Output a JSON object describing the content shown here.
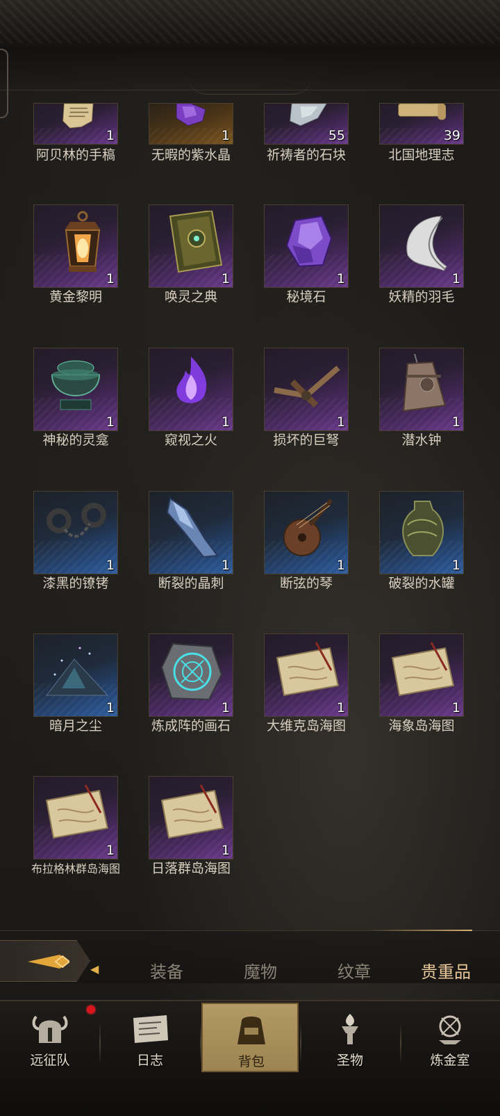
{
  "items": [
    {
      "name": "阿贝林的手稿",
      "count": "1",
      "rarity": "purple",
      "icon": "manuscript-icon"
    },
    {
      "name": "无暇的紫水晶",
      "count": "1",
      "rarity": "orange",
      "icon": "amethyst-icon"
    },
    {
      "name": "祈祷者的石块",
      "count": "55",
      "rarity": "purple",
      "icon": "stone-icon"
    },
    {
      "name": "北国地理志",
      "count": "39",
      "rarity": "purple",
      "icon": "scroll-icon"
    },
    {
      "name": "黄金黎明",
      "count": "1",
      "rarity": "purple",
      "icon": "lantern-icon"
    },
    {
      "name": "唤灵之典",
      "count": "1",
      "rarity": "purple",
      "icon": "tome-icon"
    },
    {
      "name": "秘境石",
      "count": "1",
      "rarity": "purple",
      "icon": "crystal-icon"
    },
    {
      "name": "妖精的羽毛",
      "count": "1",
      "rarity": "purple",
      "icon": "feather-icon"
    },
    {
      "name": "神秘的灵龛",
      "count": "1",
      "rarity": "purple",
      "icon": "censer-icon"
    },
    {
      "name": "窥视之火",
      "count": "1",
      "rarity": "purple",
      "icon": "flame-icon"
    },
    {
      "name": "损坏的巨弩",
      "count": "1",
      "rarity": "purple",
      "icon": "crossbow-icon"
    },
    {
      "name": "潜水钟",
      "count": "1",
      "rarity": "purple",
      "icon": "bell-icon"
    },
    {
      "name": "漆黑的镣铐",
      "count": "1",
      "rarity": "blue",
      "icon": "shackles-icon"
    },
    {
      "name": "断裂的晶刺",
      "count": "1",
      "rarity": "blue",
      "icon": "shard-icon"
    },
    {
      "name": "断弦的琴",
      "count": "1",
      "rarity": "blue",
      "icon": "lute-icon"
    },
    {
      "name": "破裂的水罐",
      "count": "1",
      "rarity": "blue",
      "icon": "jug-icon"
    },
    {
      "name": "暗月之尘",
      "count": "1",
      "rarity": "blue",
      "icon": "dust-icon"
    },
    {
      "name": "炼成阵的画石",
      "count": "1",
      "rarity": "purple",
      "icon": "rune-stone-icon"
    },
    {
      "name": "大维克岛海图",
      "count": "1",
      "rarity": "purple",
      "icon": "sea-chart-icon"
    },
    {
      "name": "海象岛海图",
      "count": "1",
      "rarity": "purple",
      "icon": "sea-chart-icon"
    },
    {
      "name": "布拉格林群岛海图",
      "count": "1",
      "rarity": "purple",
      "icon": "sea-chart-icon"
    },
    {
      "name": "日落群岛海图",
      "count": "1",
      "rarity": "purple",
      "icon": "sea-chart-icon"
    }
  ],
  "categories": {
    "equipment": "装备",
    "monsters": "魔物",
    "crests": "纹章",
    "valuables": "贵重品",
    "active": "valuables"
  },
  "nav": {
    "expedition": "远征队",
    "journal": "日志",
    "backpack": "背包",
    "relics": "圣物",
    "alchemy": "炼金室",
    "active": "backpack"
  },
  "colors": {
    "purple": "#6a3a8a",
    "blue": "#2f5e9e",
    "orange": "#7a5420",
    "active_tab": "#e9c79a",
    "notification": "#d8151b"
  }
}
